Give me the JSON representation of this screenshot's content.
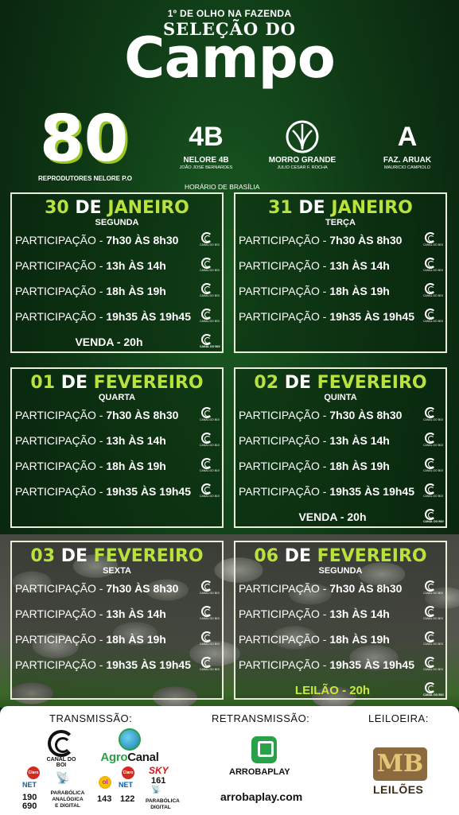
{
  "header": {
    "top_title": "1º DE OLHO NA FAZENDA",
    "subtitle": "SELEÇÃO DO",
    "title": "Campo",
    "count": "80",
    "count_label": "REPRODUTORES NELORE P.O",
    "timezone": "HORÁRIO DE BRASÍLIA"
  },
  "brands": [
    {
      "logo": "4B",
      "name": "NELORE 4B",
      "owner": "JOÃO JOSÉ BERNARDES"
    },
    {
      "logo": "",
      "name": "MORRO GRANDE",
      "owner": "JULIO CESAR F. ROCHA"
    },
    {
      "logo": "A",
      "name": "FAZ. ARUAK",
      "owner": "MAURICIO CAMPIOLO"
    }
  ],
  "schedule_label": "PARTICIPAÇÃO -",
  "canal_tag": "CANAL DO BOI",
  "days": [
    {
      "num": "30",
      "de": "DE",
      "month": "JANEIRO",
      "weekday": "SEGUNDA",
      "times": [
        "7h30 ÀS 8h30",
        "13h ÀS 14h",
        "18h ÀS 19h",
        "19h35 ÀS 19h45"
      ],
      "final": "VENDA - 20h"
    },
    {
      "num": "31",
      "de": "DE",
      "month": "JANEIRO",
      "weekday": "TERÇA",
      "times": [
        "7h30 ÀS 8h30",
        "13h ÀS 14h",
        "18h ÀS 19h",
        "19h35 ÀS 19h45"
      ],
      "final": ""
    },
    {
      "num": "01",
      "de": "DE",
      "month": "FEVEREIRO",
      "weekday": "QUARTA",
      "times": [
        "7h30 ÀS 8h30",
        "13h ÀS 14h",
        "18h ÀS 19h",
        "19h35 ÀS 19h45"
      ],
      "final": ""
    },
    {
      "num": "02",
      "de": "DE",
      "month": "FEVEREIRO",
      "weekday": "QUINTA",
      "times": [
        "7h30 ÀS 8h30",
        "13h ÀS 14h",
        "18h ÀS 19h",
        "19h35 ÀS 19h45"
      ],
      "final": "VENDA - 20h"
    },
    {
      "num": "03",
      "de": "DE",
      "month": "FEVEREIRO",
      "weekday": "SEXTA",
      "times": [
        "7h30 ÀS 8h30",
        "13h ÀS 14h",
        "18h ÀS 19h",
        "19h35 ÀS 19h45"
      ],
      "final": ""
    },
    {
      "num": "06",
      "de": "DE",
      "month": "FEVEREIRO",
      "weekday": "SEGUNDA",
      "times": [
        "7h30 ÀS 8h30",
        "13h ÀS 14h",
        "18h ÀS 19h",
        "19h35 ÀS 19h45"
      ],
      "final": "LEILÃO - 20h"
    }
  ],
  "footer": {
    "transmission_label": "TRANSMISSÃO:",
    "retransmission_label": "RETRANSMISSÃO:",
    "auctioneer_label": "LEILOEIRA:",
    "canal_name": "CANAL DO BOI",
    "agro_name_a": "Agro",
    "agro_name_b": "Canal",
    "claro": "Claro",
    "net": "NET",
    "canal_channels_1": "190",
    "canal_channels_2": "690",
    "parabolica_1": "PARABÓLICA",
    "parabolica_2": "ANALÓGICA",
    "parabolica_3": "E DIGITAL",
    "oi": "oi",
    "sky": "SKY",
    "agro_sky": "161",
    "agro_oi": "143",
    "agro_net": "122",
    "parabolica_digital_1": "PARABÓLICA",
    "parabolica_digital_2": "DIGITAL",
    "arrobaplay_name": "ARROBAPLAY",
    "arrobaplay_url": "arrobaplay.com",
    "mb_logo": "MB",
    "mb_name": "LEILÕES"
  },
  "colors": {
    "accent": "#b9e23c",
    "bg_green": "#0f3a16",
    "border": "#e9edd9"
  }
}
